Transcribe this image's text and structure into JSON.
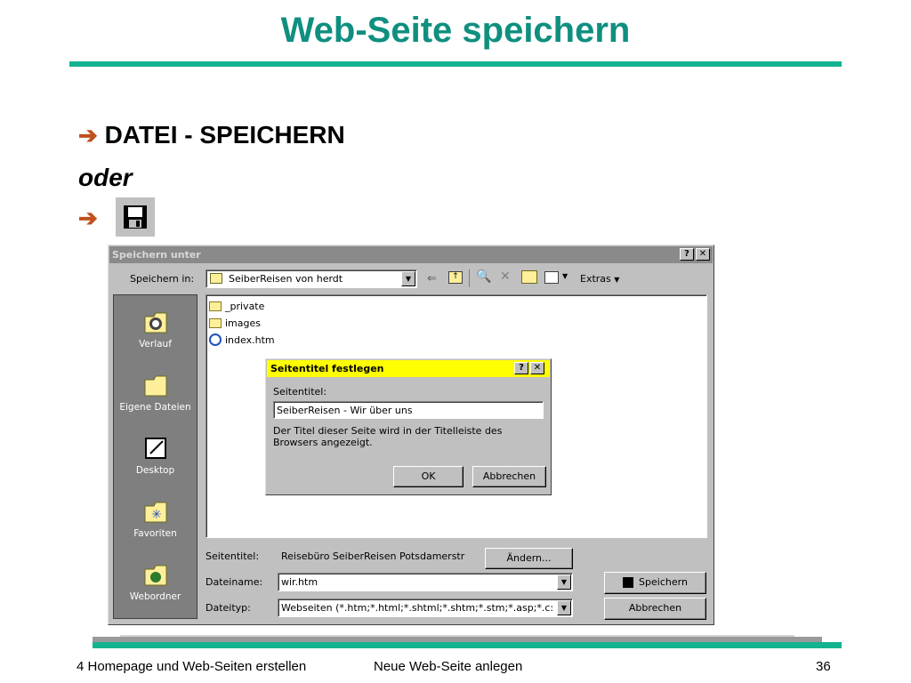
{
  "slide": {
    "title": "Web-Seite speichern",
    "bullet1": "DATEI - SPEICHERN",
    "bullet2": "oder",
    "arrow": "➔",
    "save_icon": "floppy-disk-icon"
  },
  "dialog": {
    "title": "Speichern unter",
    "help": "?",
    "close": "✕",
    "save_in_label": "Speichern in:",
    "save_in_value": "SeiberReisen von herdt",
    "extras": "Extras",
    "places": [
      {
        "label": "Verlauf",
        "icon": "history-icon"
      },
      {
        "label": "Eigene Dateien",
        "icon": "my-documents-icon"
      },
      {
        "label": "Desktop",
        "icon": "desktop-icon"
      },
      {
        "label": "Favoriten",
        "icon": "favorites-icon"
      },
      {
        "label": "Webordner",
        "icon": "web-folders-icon"
      }
    ],
    "files": [
      "_private",
      "images",
      "index.htm"
    ],
    "page_title_label": "Seitentitel:",
    "page_title_value": "Reisebüro SeiberReisen Potsdamerstr",
    "change_button": "Ändern...",
    "filename_label": "Dateiname:",
    "filename_value": "wir.htm",
    "filetype_label": "Dateityp:",
    "filetype_value": "Webseiten (*.htm;*.html;*.shtml;*.shtm;*.stm;*.asp;*.c:",
    "save_button": "Speichern",
    "cancel_button": "Abbrechen"
  },
  "subdialog": {
    "title": "Seitentitel festlegen",
    "help": "?",
    "close": "✕",
    "field_label": "Seitentitel:",
    "field_value": "SeiberReisen - Wir über uns",
    "description": "Der Titel dieser Seite wird in der Titelleiste des Browsers angezeigt.",
    "ok_button": "OK",
    "cancel_button": "Abbrechen"
  },
  "footer": {
    "left": "4 Homepage und Web-Seiten erstellen",
    "center": "Neue Web-Seite anlegen",
    "page": "36"
  },
  "colors": {
    "title": "#0f8f7f",
    "rule": "#13b38f",
    "arrow": "#c0501c",
    "subdialog_titlebar": "#ffff00"
  }
}
